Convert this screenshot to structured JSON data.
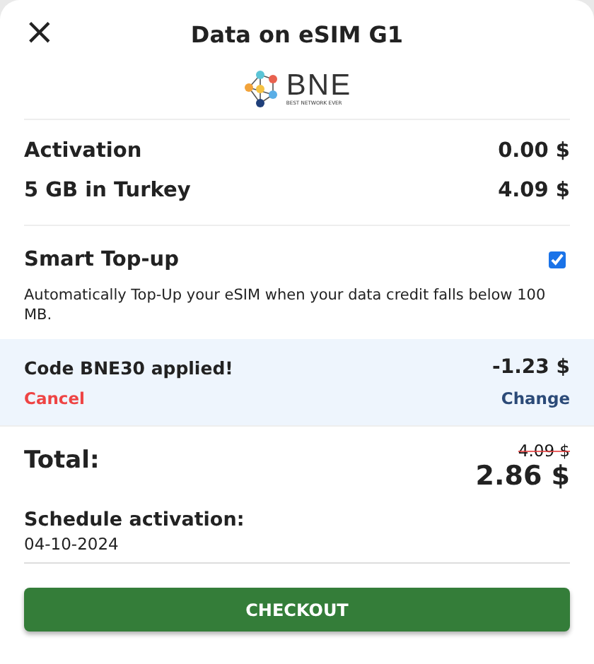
{
  "header": {
    "close": "×",
    "title": "Data on eSIM G1"
  },
  "logo": {
    "name": "BNE",
    "tagline": "BEST NETWORK EVER"
  },
  "items": [
    {
      "label": "Activation",
      "price": "0.00 $"
    },
    {
      "label": "5 GB in Turkey",
      "price": "4.09 $"
    }
  ],
  "smart_topup": {
    "title": "Smart Top-up",
    "checked": true,
    "description": "Automatically Top-Up your eSIM when your data credit falls below 100 MB."
  },
  "promo": {
    "text": "Code BNE30 applied!",
    "amount": "-1.23 $",
    "cancel": "Cancel",
    "change": "Change"
  },
  "total": {
    "label": "Total:",
    "old_price": "4.09 $",
    "price": "2.86 $"
  },
  "schedule": {
    "label": "Schedule activation:",
    "value": "04-10-2024"
  },
  "checkout": "CHECKOUT"
}
